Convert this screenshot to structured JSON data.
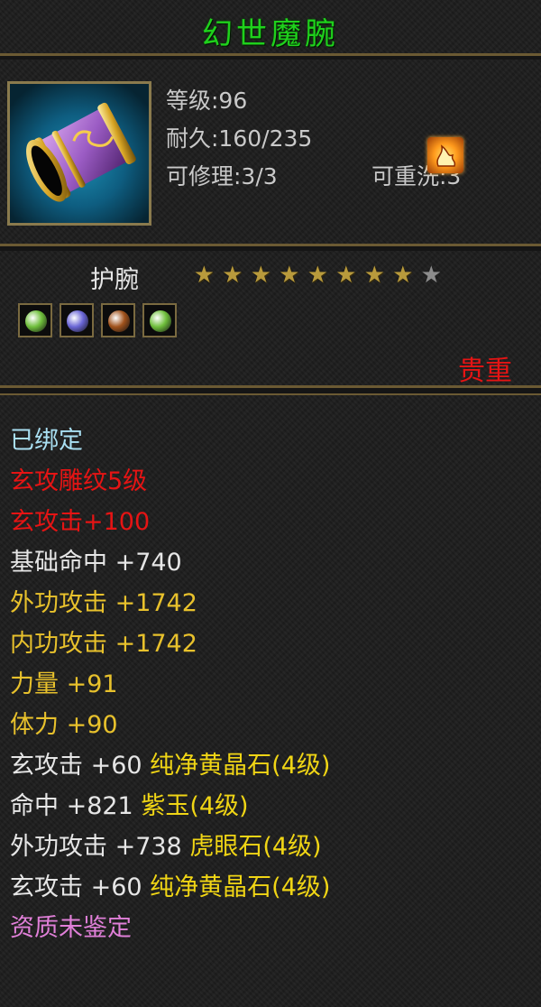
{
  "item": {
    "name": "幻世魔腕",
    "level_text": "等级:96",
    "durability_text": "耐久:160/235",
    "repair_text": "可修理:3/3",
    "rewash_text": "可重洗:3",
    "type": "护腕",
    "stars_filled": 8,
    "stars_total": 9,
    "quality": "贵重"
  },
  "gems": [
    {
      "icon": "green-gem-icon",
      "color": "#6fbf3c"
    },
    {
      "icon": "purple-gem-icon",
      "color": "#6a66d6"
    },
    {
      "icon": "brown-gem-icon",
      "color": "#a0521c"
    },
    {
      "icon": "green-gem-icon",
      "color": "#6fbf3c"
    }
  ],
  "colors": {
    "title": "#1fd11c",
    "bound": "#a9dff2",
    "red": "#e51414",
    "white": "#e6e6e6",
    "yellow": "#e8c12c",
    "gold": "#f0d515",
    "pink": "#e07fd8"
  },
  "attributes": [
    {
      "text": "已绑定",
      "color": "#a9dff2"
    },
    {
      "text": "玄攻雕纹5级",
      "color": "#e51414"
    },
    {
      "text": "玄攻击+100",
      "color": "#e51414"
    },
    {
      "text": "基础命中 +740",
      "color": "#e6e6e6"
    },
    {
      "text": "外功攻击 +1742",
      "color": "#e8c12c"
    },
    {
      "text": "内功攻击 +1742",
      "color": "#e8c12c"
    },
    {
      "text": "力量 +91",
      "color": "#e8c12c"
    },
    {
      "text": "体力 +90",
      "color": "#e8c12c"
    },
    {
      "text": "玄攻击 +60 ",
      "color": "#e6e6e6",
      "suffix": "纯净黄晶石(4级)"
    },
    {
      "text": "命中 +821 ",
      "color": "#e6e6e6",
      "suffix": "紫玉(4级)"
    },
    {
      "text": "外功攻击 +738 ",
      "color": "#e6e6e6",
      "suffix": "虎眼石(4级)"
    },
    {
      "text": "玄攻击 +60 ",
      "color": "#e6e6e6",
      "suffix": "纯净黄晶石(4级)"
    },
    {
      "text": "资质未鉴定",
      "color": "#e07fd8"
    }
  ]
}
